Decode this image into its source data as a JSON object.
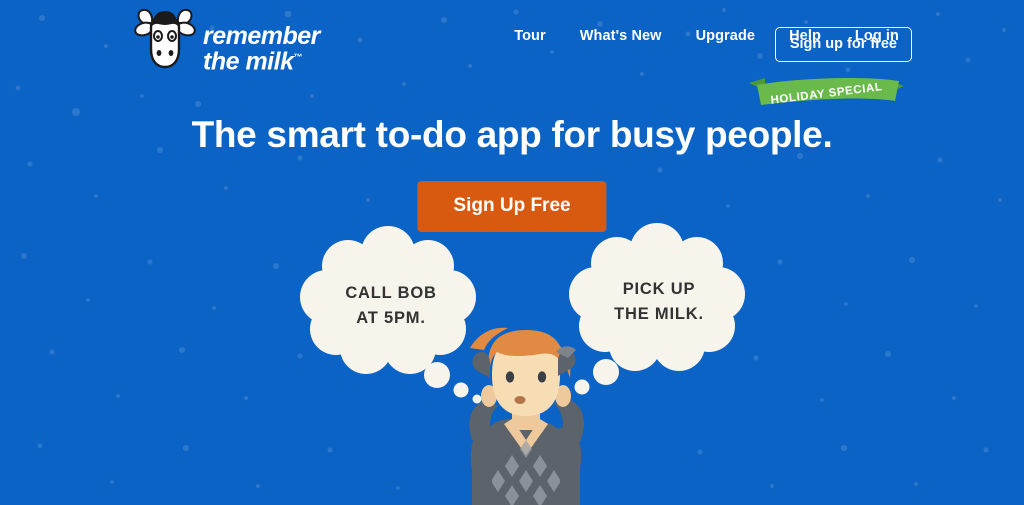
{
  "site": {
    "background_color": "#0b63c5",
    "accent_orange": "#d75a10",
    "ribbon_green": "#6ab94b",
    "bubble_cream": "#f7f4ec"
  },
  "header": {
    "logo": {
      "name": "remember the milk",
      "line1": "remember",
      "line2": "the milk",
      "trademark": "™",
      "icon": "cow-logo-icon"
    },
    "nav": [
      {
        "label": "Tour",
        "name": "nav-tour"
      },
      {
        "label": "What's New",
        "name": "nav-whats-new"
      },
      {
        "label": "Upgrade",
        "name": "nav-upgrade"
      },
      {
        "label": "Help",
        "name": "nav-help"
      },
      {
        "label": "Log in",
        "name": "nav-login"
      }
    ],
    "signup_button": "Sign up for free"
  },
  "ribbon": {
    "label": "HOLIDAY SPECIAL"
  },
  "hero": {
    "headline": "The smart to-do app for busy people.",
    "cta_label": "Sign Up Free"
  },
  "illustration": {
    "bubble_left": "CALL BOB\nAT 5PM.",
    "bubble_right": "PICK UP\nTHE MILK.",
    "character": "stressed-man-character",
    "hair_color": "#e08a43",
    "skin_color": "#f7ddb4",
    "sweater_color": "#5d636b"
  }
}
